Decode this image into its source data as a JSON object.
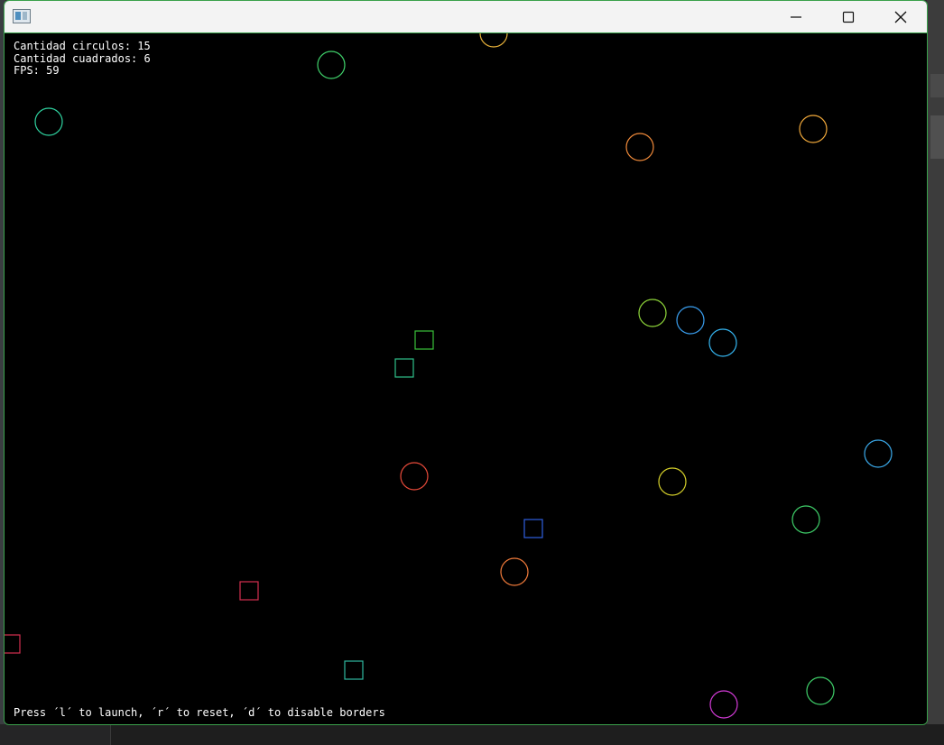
{
  "hud": {
    "circles_line": "Cantidad circulos: 15",
    "squares_line": "Cantidad cuadrados: 6",
    "fps_line": "FPS: 59"
  },
  "footer": {
    "instructions": "Press ´l´ to launch, ´r´ to reset, ´d´ to disable borders"
  },
  "window": {
    "border_color": "#3aa14b",
    "icons": [
      "app-icon",
      "minimize-icon",
      "maximize-icon",
      "close-icon"
    ]
  },
  "shapes": {
    "circles": [
      {
        "color": "#e8b23a"
      },
      {
        "color": "#3fd06a"
      },
      {
        "color": "#2fd3a0"
      },
      {
        "color": "#f08a3a"
      },
      {
        "color": "#f0a83a"
      },
      {
        "color": "#8fd63a"
      },
      {
        "color": "#3a9ff0"
      },
      {
        "color": "#35b5f0"
      },
      {
        "color": "#3aa8e8"
      },
      {
        "color": "#e84a3a"
      },
      {
        "color": "#d6d12a"
      },
      {
        "color": "#3fd06a"
      },
      {
        "color": "#f07a3a"
      },
      {
        "color": "#3fd06a"
      },
      {
        "color": "#d23ad6"
      }
    ],
    "squares": [
      {
        "color": "#3ac03a"
      },
      {
        "color": "#2fc08a"
      },
      {
        "color": "#2f5fe0"
      },
      {
        "color": "#d6304f"
      },
      {
        "color": "#d6304f"
      },
      {
        "color": "#2fb8a0"
      }
    ]
  }
}
